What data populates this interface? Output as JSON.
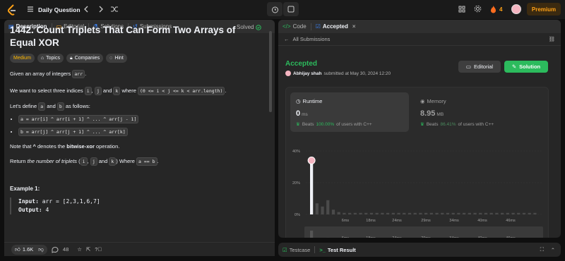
{
  "nav": {
    "title": "Daily Question",
    "streak": "4",
    "premium": "Premium"
  },
  "left": {
    "tabs": [
      {
        "label": "Description"
      },
      {
        "label": "Editorial"
      },
      {
        "label": "Solutions"
      },
      {
        "label": "Submissions"
      }
    ],
    "title": "1442. Count Triplets That Can Form Two Arrays of Equal XOR",
    "solved": "Solved",
    "chips": {
      "difficulty": "Medium",
      "topics": "Topics",
      "companies": "Companies",
      "hint": "Hint"
    },
    "p1_pre": "Given an array of integers ",
    "p1_code": "arr",
    "p1_post": ".",
    "p2_pre": "We want to select three indices ",
    "p2_i": "i",
    "p2_c1": ", ",
    "p2_j": "j",
    "p2_and": " and ",
    "p2_k": "k",
    "p2_where": " where ",
    "p2_cond": "(0 <= i < j <= k < arr.length)",
    "p2_end": ".",
    "p3_pre": "Let's define ",
    "p3_a": "a",
    "p3_and": " and ",
    "p3_b": "b",
    "p3_post": " as follows:",
    "bullet_a": "a = arr[i] ^ arr[i + 1] ^ ... ^ arr[j - 1]",
    "bullet_b": "b = arr[j] ^ arr[j + 1] ^ ... ^ arr[k]",
    "p4_pre": "Note that ",
    "p4_caret": "^",
    "p4_mid": " denotes the ",
    "p4_bold": "bitwise-xor",
    "p4_post": " operation.",
    "p5_pre": "Return ",
    "p5_em": "the number of triplets",
    "p5_i": "i",
    "p5_c": ", ",
    "p5_j": "j",
    "p5_and": " and ",
    "p5_k": "k",
    "p5_where": ") Where ",
    "p5_cond": "a == b",
    "p5_end": ".",
    "example_title": "Example 1:",
    "input_label": "Input:",
    "input_val": " arr = [2,3,1,6,7]",
    "output_label": "Output:",
    "output_val": " 4",
    "likes": "1.6K",
    "comments": "48"
  },
  "right": {
    "tabs": [
      {
        "label": "Code"
      },
      {
        "label": "Accepted"
      }
    ],
    "all_submissions": "All Submissions",
    "status": "Accepted",
    "user": "Abhijay shah",
    "submitted": " submitted at May 30, 2024 12:20",
    "editorial_btn": "Editorial",
    "solution_btn": "Solution",
    "runtime": {
      "label": "Runtime",
      "value": "0",
      "unit": "ms",
      "beats_pre": "Beats ",
      "beats_pct": "100.00%",
      "beats_post": " of users with C++"
    },
    "memory": {
      "label": "Memory",
      "value": "8.95",
      "unit": "MB",
      "beats_pre": "Beats ",
      "beats_pct": "86.41%",
      "beats_post": " of users with C++"
    },
    "footer": {
      "testcase": "Testcase",
      "result": "Test Result"
    }
  },
  "colors": {
    "accent": "#ffa116",
    "success": "#2cbb5d",
    "medium": "#ffb800"
  },
  "chart_data": {
    "type": "bar",
    "title": "",
    "ylabel": "",
    "yticks": [
      "40%",
      "20%",
      "0%"
    ],
    "ylim": [
      0,
      40
    ],
    "xticks": [
      "6ms",
      "18ms",
      "24ms",
      "29ms",
      "34ms",
      "40ms",
      "46ms"
    ],
    "values": [
      34,
      7,
      5,
      9,
      3,
      1.5,
      1,
      1,
      1,
      1,
      1,
      1,
      1,
      1,
      1,
      1,
      1,
      1,
      1,
      1,
      1,
      1,
      1,
      1,
      1,
      1,
      1,
      1,
      1,
      1,
      1,
      1,
      1,
      1,
      1,
      1,
      1,
      1,
      1,
      1,
      1,
      1
    ]
  }
}
